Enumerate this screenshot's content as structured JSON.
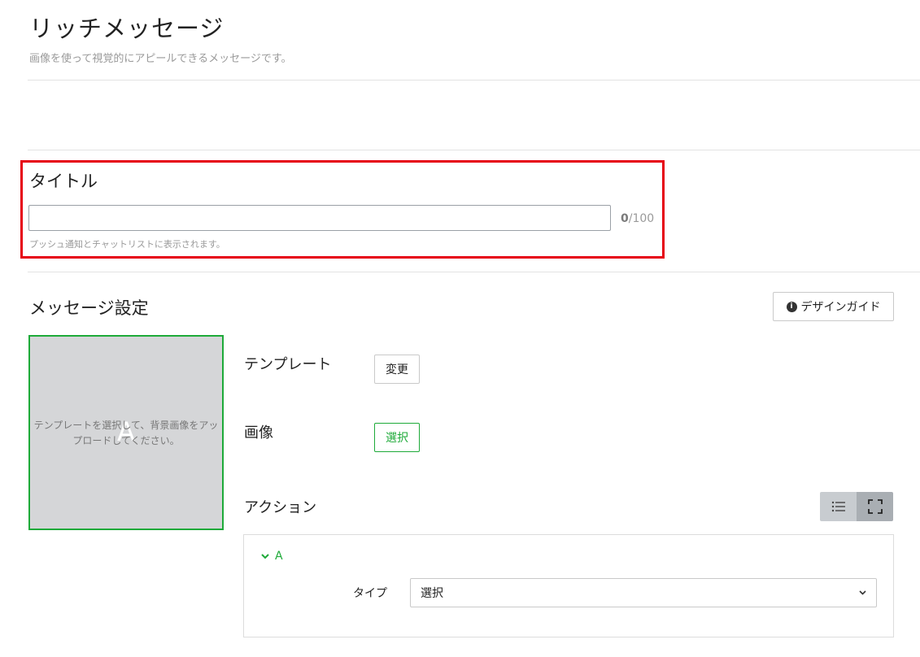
{
  "header": {
    "title": "リッチメッセージ",
    "subtitle": "画像を使って視覚的にアピールできるメッセージです。"
  },
  "title_section": {
    "heading": "タイトル",
    "input_value": "",
    "counter_current": "0",
    "counter_max": "/100",
    "hint": "プッシュ通知とチャットリストに表示されます。"
  },
  "message_settings": {
    "heading": "メッセージ設定",
    "design_guide_label": "デザインガイド",
    "preview": {
      "letter": "A",
      "placeholder": "テンプレートを選択して、背景画像をアップロードしてください。"
    },
    "template_label": "テンプレート",
    "template_button": "変更",
    "image_label": "画像",
    "image_button": "選択",
    "action_label": "アクション",
    "view_toggle": [
      "list-icon",
      "expand-icon"
    ],
    "actions": [
      {
        "name": "A",
        "type_label": "タイプ",
        "type_value": "選択"
      }
    ]
  },
  "colors": {
    "accent_green": "#1eaa39",
    "highlight_red": "#e60012"
  }
}
